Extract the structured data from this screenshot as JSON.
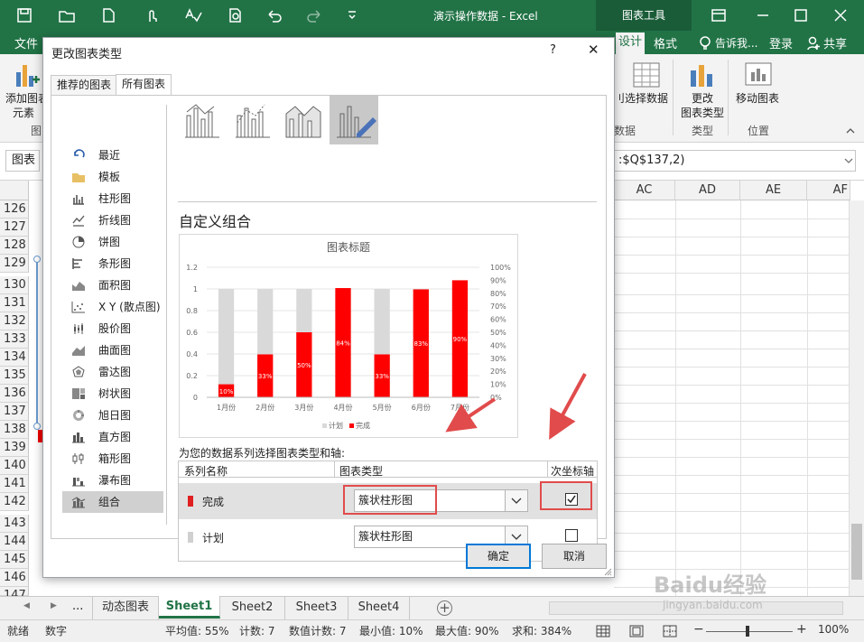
{
  "window": {
    "title": "演示操作数据 - Excel",
    "context_tab": "图表工具",
    "controls": [
      "restore",
      "minimize",
      "maximize",
      "close"
    ]
  },
  "ribbon_tabs": {
    "file": "文件",
    "design": "设计",
    "format": "格式",
    "tell_me": "告诉我...",
    "login": "登录",
    "share": "共享"
  },
  "ribbon": {
    "add_chart_element": "添加图表元素",
    "add_chart_element_line1": "添加图表",
    "add_chart_element_line2": "元素",
    "group_chart_layouts_partial": "图",
    "select_data_prefix": "刂",
    "select_data": "选择数据",
    "group_data": "数据",
    "change_chart_type_line1": "更改",
    "change_chart_type_line2": "图表类型",
    "group_type": "类型",
    "move_chart": "移动图表",
    "group_location": "位置"
  },
  "formula_bar": {
    "name_box": "图表",
    "formula_tail": ":$Q$137,2)"
  },
  "columns": [
    "AC",
    "AD",
    "AE",
    "AF"
  ],
  "rows": [
    "126",
    "127",
    "128",
    "129",
    "130",
    "131",
    "132",
    "133",
    "134",
    "135",
    "136",
    "137",
    "138",
    "139",
    "140",
    "141",
    "142",
    "143",
    "144",
    "145",
    "146",
    "147"
  ],
  "sheet_tabs": {
    "nav_prev": "◀",
    "nav_next": "▶",
    "ellipsis": "...",
    "tabs": [
      "动态图表",
      "Sheet1",
      "Sheet2",
      "Sheet3",
      "Sheet4"
    ],
    "active": "Sheet1",
    "add": "+"
  },
  "status_bar": {
    "ready": "就绪",
    "mode": "数字",
    "average": "平均值: 55%",
    "count": "计数: 7",
    "numeric_count": "数值计数: 7",
    "min": "最小值: 10%",
    "max": "最大值: 90%",
    "sum": "求和: 384%",
    "zoom": "100%",
    "zoom_minus": "−",
    "zoom_plus": "+"
  },
  "watermark": {
    "line1": "Baidu经验",
    "line2": "jingyan.baidu.com"
  },
  "dialog": {
    "title": "更改图表类型",
    "help": "?",
    "close": "✕",
    "tabs": [
      "推荐的图表",
      "所有图表"
    ],
    "active_tab": "所有图表",
    "categories": [
      "最近",
      "模板",
      "柱形图",
      "折线图",
      "饼图",
      "条形图",
      "面积图",
      "X Y (散点图)",
      "股价图",
      "曲面图",
      "雷达图",
      "树状图",
      "旭日图",
      "直方图",
      "箱形图",
      "瀑布图",
      "组合"
    ],
    "selected_category": "组合",
    "section_title": "自定义组合",
    "series_prompt": "为您的数据系列选择图表类型和轴:",
    "table_headers": [
      "系列名称",
      "图表类型",
      "次坐标轴"
    ],
    "series_rows": [
      {
        "name": "完成",
        "color": "#e02020",
        "type": "簇状柱形图",
        "secondary_axis": true
      },
      {
        "name": "计划",
        "color": "#d0d0d0",
        "type": "簇状柱形图",
        "secondary_axis": false
      }
    ],
    "ok": "确定",
    "cancel": "取消"
  },
  "chart_data": {
    "type": "bar",
    "title": "图表标题",
    "categories": [
      "1月份",
      "2月份",
      "3月份",
      "4月份",
      "5月份",
      "6月份",
      "7月份"
    ],
    "series": [
      {
        "name": "计划",
        "axis": "primary",
        "color": "#d9d9d9",
        "values": [
          1,
          1,
          1,
          1,
          1,
          1,
          1
        ]
      },
      {
        "name": "完成",
        "axis": "secondary",
        "color": "#ff0000",
        "values": [
          0.1,
          0.33,
          0.5,
          0.84,
          0.33,
          0.83,
          0.9
        ],
        "data_labels": [
          "10%",
          "33%",
          "50%",
          "84%",
          "33%",
          "83%",
          "90%"
        ]
      }
    ],
    "ylim": [
      0,
      1.2
    ],
    "y_ticks": [
      "0",
      "0.2",
      "0.4",
      "0.6",
      "0.8",
      "1",
      "1.2"
    ],
    "y2lim": [
      0,
      1
    ],
    "y2_ticks": [
      "0%",
      "10%",
      "20%",
      "30%",
      "40%",
      "50%",
      "60%",
      "70%",
      "80%",
      "90%",
      "100%"
    ],
    "legend": "bottom",
    "legend_entries": [
      "计划",
      "完成"
    ],
    "grid": true
  }
}
